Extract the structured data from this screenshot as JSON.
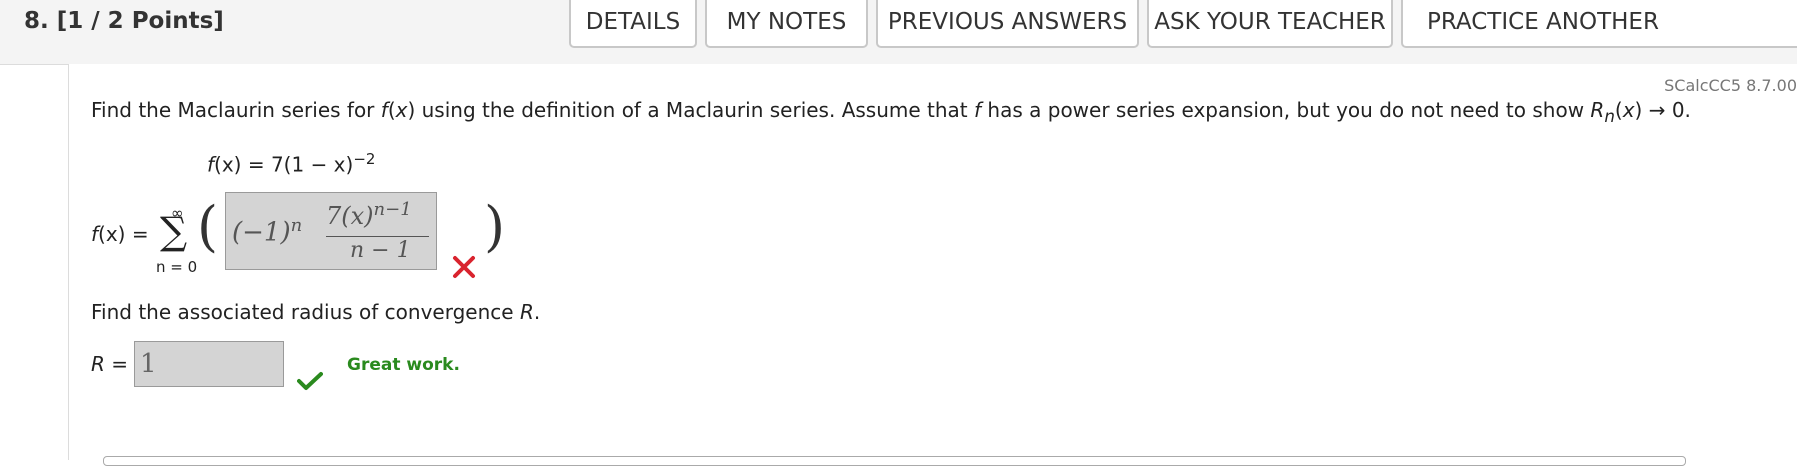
{
  "question": {
    "title": "8.  [1 / 2 Points]",
    "source": "SCalcCC5 8.7.00"
  },
  "tabs": [
    {
      "label": "DETAILS"
    },
    {
      "label": "MY NOTES"
    },
    {
      "label": "PREVIOUS ANSWERS"
    },
    {
      "label": "ASK YOUR TEACHER"
    },
    {
      "label": "PRACTICE ANOTHER"
    }
  ],
  "prompt": {
    "p1": "Find the Maclaurin series for ",
    "f": "f",
    "p2": "(",
    "x": "x",
    "p3": ") using the definition of a Maclaurin series. Assume that ",
    "f2": "f",
    "p4": " has a power series expansion, but you do not need to show ",
    "R": "R",
    "n": "n",
    "p5": "(",
    "x2": "x",
    "p6": ") → 0."
  },
  "function_def": {
    "f": "f",
    "lhs": "(x) = 7(1 − x)",
    "exponent": "−2"
  },
  "series": {
    "lhs_f": "f",
    "lhs_rest": "(x) =",
    "sigma": "∑",
    "upper": "∞",
    "lower": "n = 0",
    "open_paren": "(",
    "close_paren": ")",
    "answer": {
      "neg_base": "(−1)",
      "neg_exp": "n",
      "numerator_base": "7(x)",
      "numerator_exp": "n−1",
      "denominator": "n − 1"
    },
    "status": "incorrect"
  },
  "radius": {
    "prompt_text": "Find the associated radius of convergence ",
    "R": "R",
    "period": ".",
    "label_R": "R",
    "label_eq": " =",
    "value": "1",
    "status": "correct",
    "feedback": "Great work."
  },
  "colors": {
    "correct": "#2a8a1e",
    "incorrect": "#d9232e",
    "answer_box_bg": "#d4d4d4"
  }
}
